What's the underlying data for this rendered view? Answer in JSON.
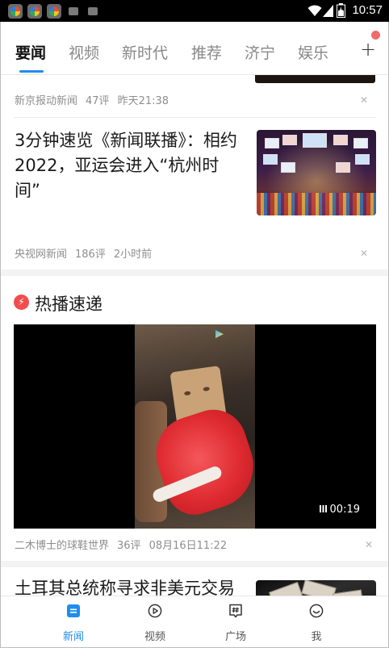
{
  "status_bar": {
    "time": "10:57"
  },
  "tabs": [
    {
      "label": "要闻",
      "active": true
    },
    {
      "label": "视频"
    },
    {
      "label": "新时代"
    },
    {
      "label": "推荐"
    },
    {
      "label": "济宁"
    },
    {
      "label": "娱乐"
    }
  ],
  "add_tab_label": "+",
  "feed": {
    "item0": {
      "source": "新京报动新闻",
      "comments": "47评",
      "time": "昨天21:38"
    },
    "item1": {
      "title": "3分钟速览《新闻联播》：相约2022，亚运会进入“杭州时间”",
      "source": "央视网新闻",
      "comments": "186评",
      "time": "2小时前"
    },
    "hot_section": {
      "title": "热播速递"
    },
    "video": {
      "duration": "00:19",
      "source": "二木博士的球鞋世界",
      "comments": "36评",
      "time": "08月16日11:22"
    },
    "item3": {
      "title": "土耳其总统称寻求非美元交易 欲打破美元垄断地位"
    }
  },
  "bottom_nav": [
    {
      "label": "新闻",
      "icon": "news-icon",
      "active": true
    },
    {
      "label": "视频",
      "icon": "play-icon"
    },
    {
      "label": "广场",
      "icon": "hashtag-icon"
    },
    {
      "label": "我",
      "icon": "smile-icon"
    }
  ],
  "colors": {
    "accent": "#1f8ded",
    "hot": "#f04e4e",
    "dot": "#f06b6b"
  }
}
